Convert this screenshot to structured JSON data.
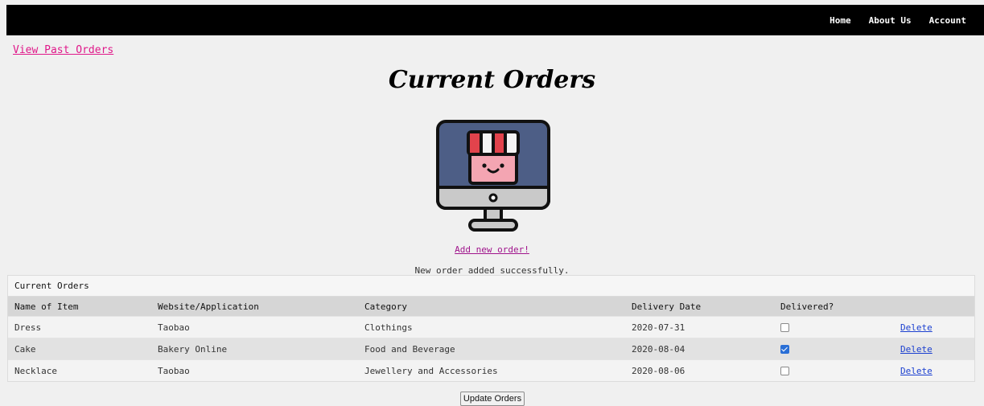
{
  "nav": {
    "home": "Home",
    "about": "About Us",
    "account": "Account"
  },
  "links": {
    "past_orders": "View Past Orders",
    "add_order": "Add new order!"
  },
  "page_title": "Current Orders",
  "status_message": "New order added successfully.",
  "table": {
    "caption": "Current Orders",
    "headers": [
      "Name of Item",
      "Website/Application",
      "Category",
      "Delivery Date",
      "Delivered?",
      ""
    ],
    "rows": [
      {
        "name": "Dress",
        "site": "Taobao",
        "category": "Clothings",
        "date": "2020-07-31",
        "delivered": false,
        "action": "Delete"
      },
      {
        "name": "Cake",
        "site": "Bakery Online",
        "category": "Food and Beverage",
        "date": "2020-08-04",
        "delivered": true,
        "action": "Delete"
      },
      {
        "name": "Necklace",
        "site": "Taobao",
        "category": "Jewellery and Accessories",
        "date": "2020-08-06",
        "delivered": false,
        "action": "Delete"
      }
    ]
  },
  "update_button": "Update Orders",
  "colors": {
    "navbar": "#000000",
    "past_orders_link": "#e0198a",
    "add_link": "#a0148c",
    "delete_link": "#1a3fd0",
    "checkbox_checked": "#2a6fd6"
  },
  "icons": {
    "hero": "shop-monitor-icon"
  }
}
